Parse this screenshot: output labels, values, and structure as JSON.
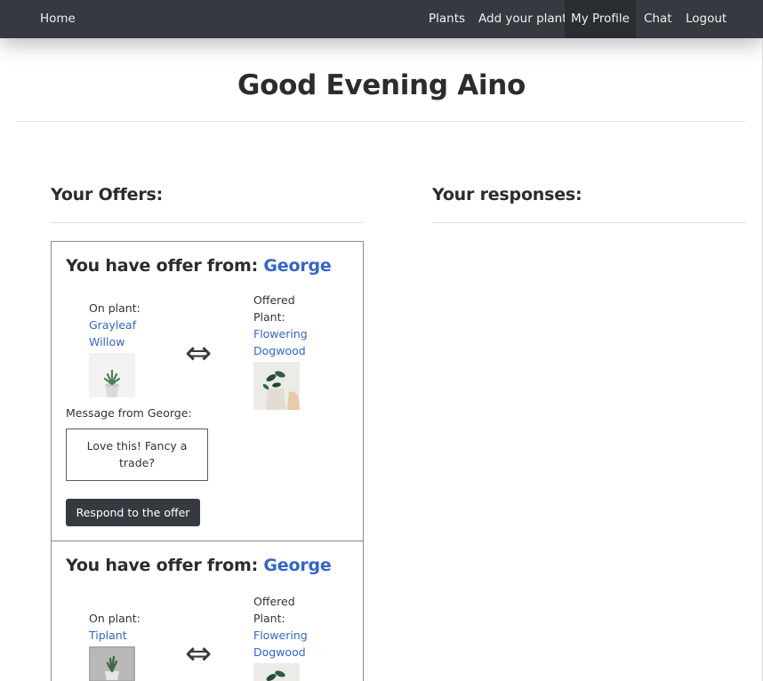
{
  "nav": {
    "home": "Home",
    "plants": "Plants",
    "add_plant": "Add your plant",
    "my_profile": "My Profile",
    "chat": "Chat",
    "logout": "Logout"
  },
  "greeting": "Good Evening Aino",
  "offers_title": "Your Offers:",
  "responses_title": "Your responses:",
  "offers": [
    {
      "heading": "You have offer from: ",
      "from": "George",
      "on_plant_label": "On plant:",
      "on_plant_name": "Grayleaf Willow",
      "arrow": "⇔",
      "offered_label": "Offered Plant:",
      "offered_name": "Flowering Dogwood",
      "message_label": "Message from George:",
      "message": "Love this! Fancy a trade?",
      "button": "Respond to the offer"
    },
    {
      "heading": "You have offer from: ",
      "from": "George",
      "on_plant_label": "On plant:",
      "on_plant_name": "Tiplant",
      "arrow": "⇔",
      "offered_label": "Offered Plant:",
      "offered_name": "Flowering Dogwood"
    }
  ]
}
